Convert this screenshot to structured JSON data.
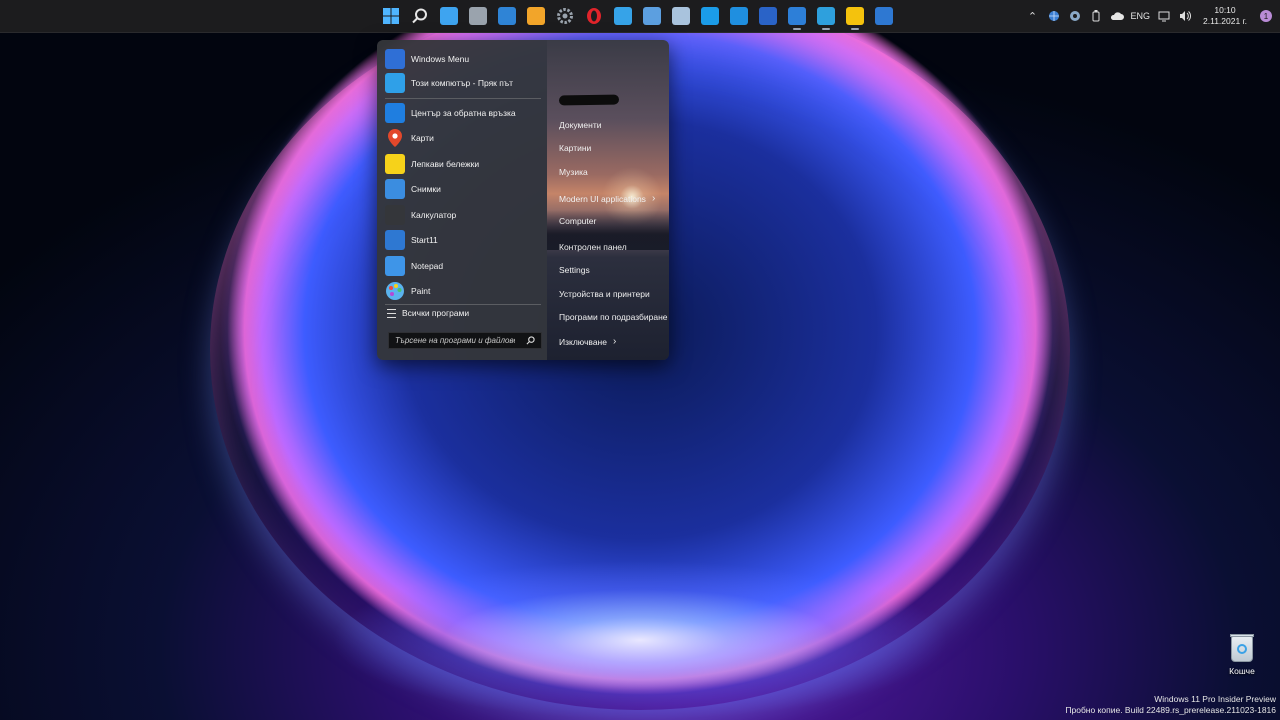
{
  "taskbar": {
    "icons": [
      {
        "name": "windows-start-icon",
        "color": "#4fb5ff",
        "active": false
      },
      {
        "name": "search-icon",
        "color": "#e6e6e6",
        "active": false
      },
      {
        "name": "task-view-icon",
        "color": "#3ea4f0",
        "active": false
      },
      {
        "name": "calculator-icon",
        "color": "#9aa3ad",
        "active": false
      },
      {
        "name": "photos-icon",
        "color": "#2f84d6",
        "active": false
      },
      {
        "name": "store-icon",
        "color": "#f2a52a",
        "active": false
      },
      {
        "name": "settings-gear-icon",
        "color": "#9aa3ad",
        "active": false
      },
      {
        "name": "opera-icon",
        "color": "#e0242b",
        "active": false
      },
      {
        "name": "monitor-icon",
        "color": "#36a3e8",
        "active": false
      },
      {
        "name": "mail-icon",
        "color": "#5c9fe0",
        "active": false
      },
      {
        "name": "chart-window-icon",
        "color": "#a9c3dd",
        "active": false
      },
      {
        "name": "skype-icon",
        "color": "#1b9ce8",
        "active": false
      },
      {
        "name": "headphones-icon",
        "color": "#1f8fe0",
        "active": false
      },
      {
        "name": "media-player-icon",
        "color": "#2a63c7",
        "active": false
      },
      {
        "name": "globe-edge-icon",
        "color": "#2d7fd8",
        "active": true
      },
      {
        "name": "telegram-icon",
        "color": "#2ea0dd",
        "active": true
      },
      {
        "name": "sticky-notes-icon",
        "color": "#f4c20d",
        "active": true
      },
      {
        "name": "start11-icon",
        "color": "#2e78d2",
        "active": false
      }
    ],
    "tray": {
      "language": "ENG",
      "time": "10:10",
      "date": "2.11.2021 г.",
      "notification_count": "1"
    }
  },
  "start_menu": {
    "programs": [
      {
        "label": "Windows Menu",
        "icon": "windows-menu-icon",
        "color": "#2f6fd6"
      },
      {
        "label": "Този компютър - Пряк път",
        "icon": "this-pc-icon",
        "color": "#2fa0e8"
      },
      {
        "label": "Център за обратна връзка",
        "icon": "feedback-hub-icon",
        "color": "#1f7ee0"
      },
      {
        "label": "Карти",
        "icon": "maps-pin-icon",
        "color": "#e3482b"
      },
      {
        "label": "Лепкави бележки",
        "icon": "sticky-notes-icon",
        "color": "#f6d21a"
      },
      {
        "label": "Снимки",
        "icon": "photos-icon",
        "color": "#3b8de0"
      },
      {
        "label": "Калкулатор",
        "icon": "calculator-icon",
        "color": "#34363a"
      },
      {
        "label": "Start11",
        "icon": "start11-icon",
        "color": "#2e78d2"
      },
      {
        "label": "Notepad",
        "icon": "notepad-icon",
        "color": "#3e95e8"
      },
      {
        "label": "Paint",
        "icon": "paint-palette-icon",
        "color": "#f2a33a"
      }
    ],
    "all_programs": "Всички програми",
    "search_placeholder": "Търсене на програми и файлове",
    "right_items": [
      {
        "label": "Документи",
        "submenu": false
      },
      {
        "label": "Картини",
        "submenu": false
      },
      {
        "label": "Музика",
        "submenu": false
      },
      {
        "label": "Modern UI applications",
        "submenu": true
      },
      {
        "label": "Computer",
        "submenu": false
      },
      {
        "label": "Контролен панел",
        "submenu": false
      },
      {
        "label": "Settings",
        "submenu": false
      },
      {
        "label": "Устройства и принтери",
        "submenu": false
      },
      {
        "label": "Програми по подразбиране",
        "submenu": false
      },
      {
        "label": "Изключване",
        "submenu": true
      }
    ]
  },
  "desktop": {
    "recycle_bin": "Кошче",
    "watermark_line1": "Windows 11 Pro Insider Preview",
    "watermark_line2": "Пробно копие. Build 22489.rs_prerelease.211023-1816"
  }
}
